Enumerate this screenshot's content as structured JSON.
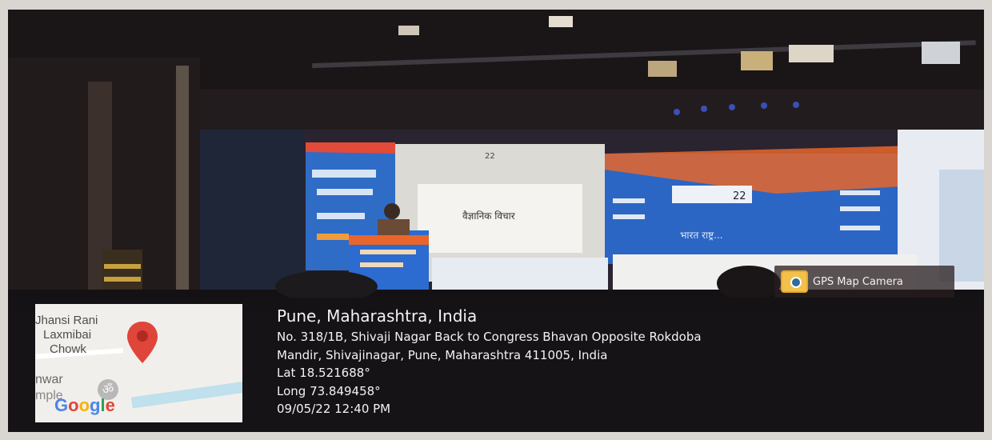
{
  "photo": {
    "description_icon": "stage-photo",
    "stage_screen_text": "वैज्ञानिक विचार",
    "year_mark": "22",
    "banner_tagline": "भारत राष्ट्र..."
  },
  "gps_badge": {
    "icon": "camera-pin-icon",
    "label": "GPS Map Camera"
  },
  "map": {
    "label_line1": "Jhansi Rani",
    "label_line2": "Laxmibai",
    "label_line3": "Chowk",
    "label_line4": "nwar",
    "label_line5": "mple",
    "pin_icon": "location-pin-icon",
    "om_icon": "ॐ",
    "logo": [
      "G",
      "o",
      "o",
      "g",
      "l",
      "e"
    ]
  },
  "location": {
    "city": "Pune, Maharashtra, India",
    "address_line1": "No. 318/1B, Shivaji Nagar Back to Congress Bhavan Opposite Rokdoba",
    "address_line2": "Mandir, Shivajinagar, Pune, Maharashtra 411005, India",
    "lat": "Lat 18.521688°",
    "long": "Long 73.849458°",
    "datetime": "09/05/22 12:40 PM"
  },
  "colors": {
    "overlay": "#141214",
    "pin": "#e0453a",
    "stage_blue": "#2b66c4",
    "stage_orange": "#e8662b"
  }
}
